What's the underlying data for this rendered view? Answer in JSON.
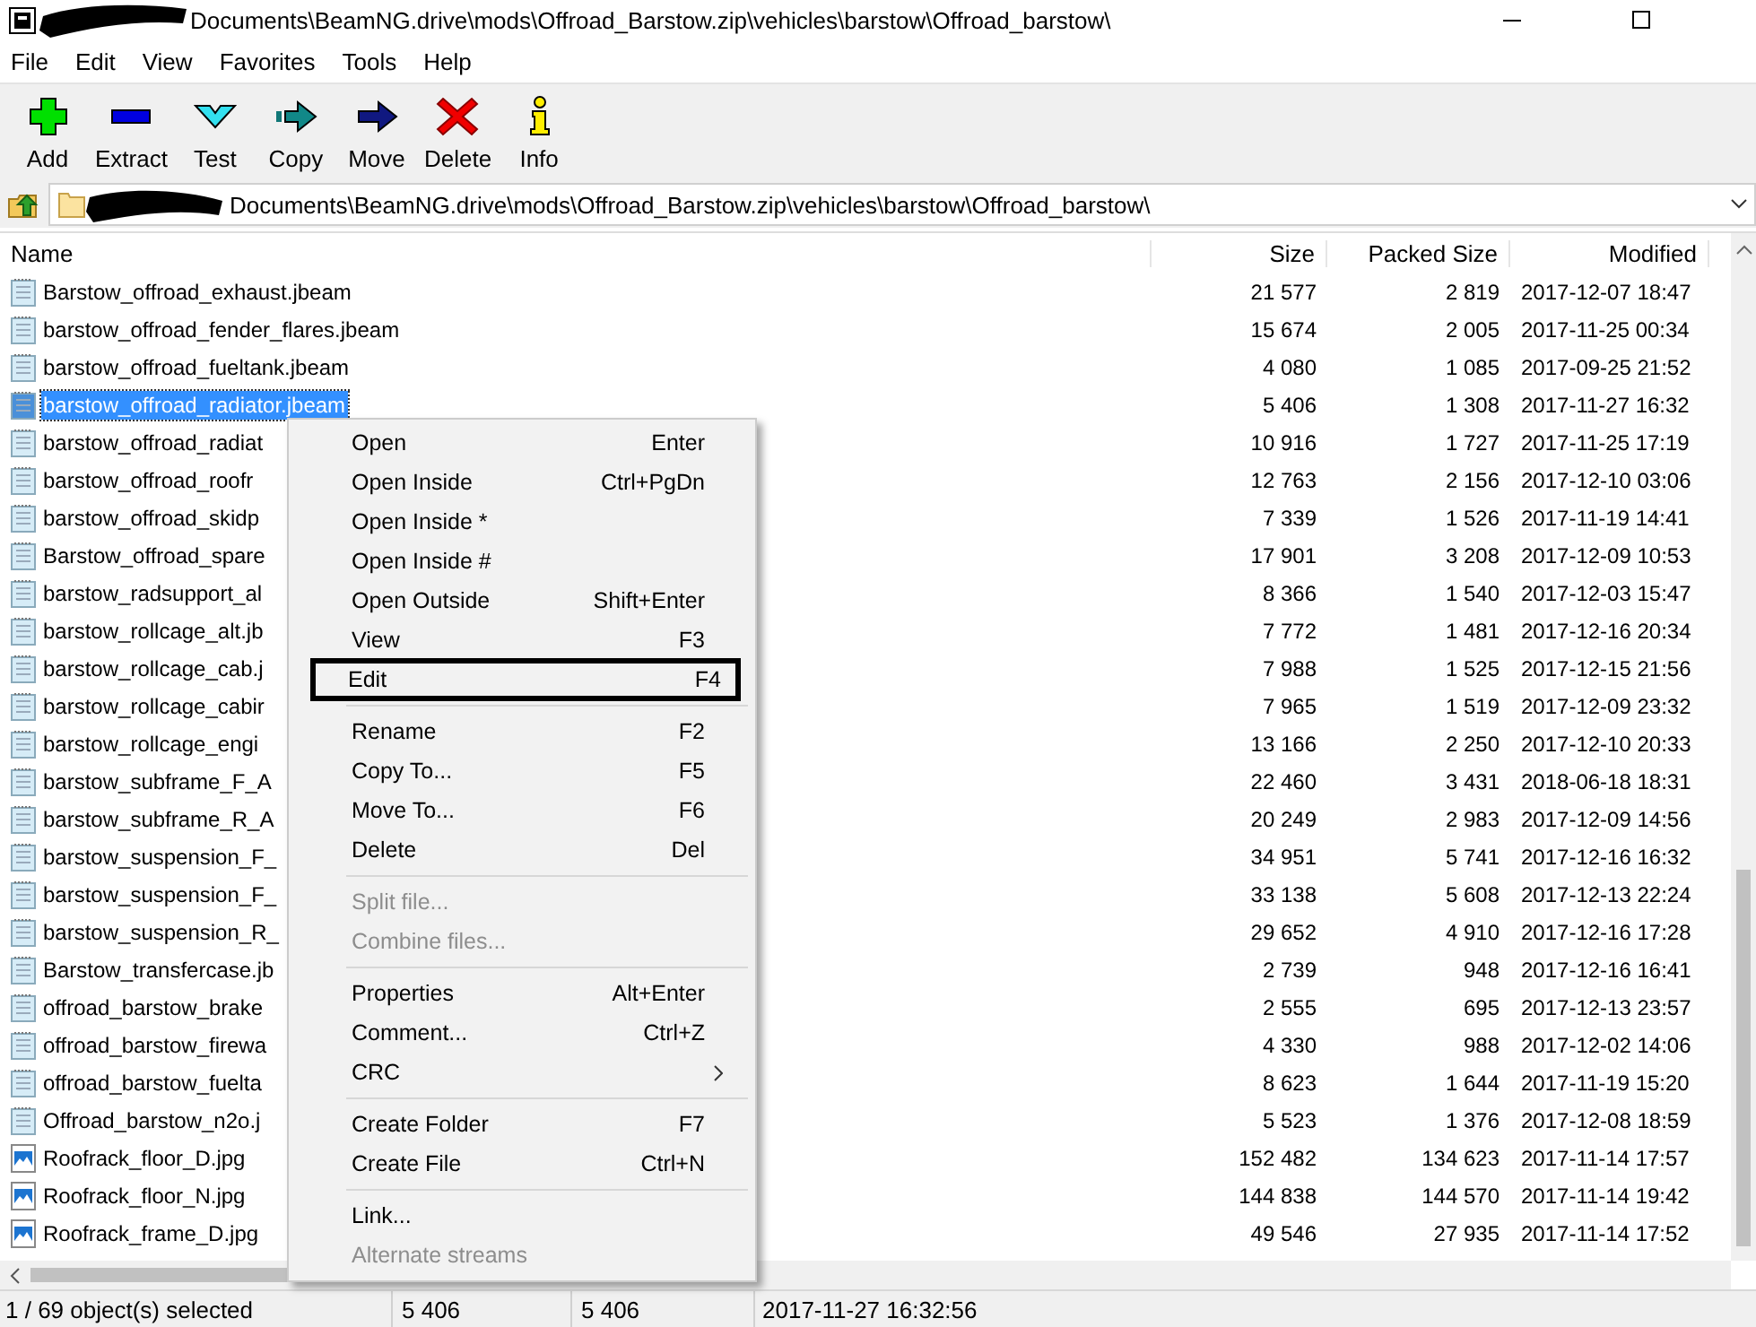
{
  "window": {
    "title": "Documents\\BeamNG.drive\\mods\\Offroad_Barstow.zip\\vehicles\\barstow\\Offroad_barstow\\"
  },
  "menu_bar": [
    "File",
    "Edit",
    "View",
    "Favorites",
    "Tools",
    "Help"
  ],
  "toolbar": [
    {
      "label": "Add",
      "kind": "add"
    },
    {
      "label": "Extract",
      "kind": "extract"
    },
    {
      "label": "Test",
      "kind": "test"
    },
    {
      "label": "Copy",
      "kind": "copy"
    },
    {
      "label": "Move",
      "kind": "move"
    },
    {
      "label": "Delete",
      "kind": "delete"
    },
    {
      "label": "Info",
      "kind": "info"
    }
  ],
  "address": {
    "value": "Documents\\BeamNG.drive\\mods\\Offroad_Barstow.zip\\vehicles\\barstow\\Offroad_barstow\\"
  },
  "table": {
    "columns": [
      "Name",
      "Size",
      "Packed Size",
      "Modified"
    ],
    "rows": [
      {
        "name": "Barstow_offroad_exhaust.jbeam",
        "kind": "text",
        "size": "21 577",
        "packed": "2 819",
        "modified": "2017-12-07 18:47",
        "selected": false
      },
      {
        "name": "barstow_offroad_fender_flares.jbeam",
        "kind": "text",
        "size": "15 674",
        "packed": "2 005",
        "modified": "2017-11-25 00:34",
        "selected": false
      },
      {
        "name": "barstow_offroad_fueltank.jbeam",
        "kind": "text",
        "size": "4 080",
        "packed": "1 085",
        "modified": "2017-09-25 21:52",
        "selected": false
      },
      {
        "name": "barstow_offroad_radiator.jbeam",
        "kind": "text",
        "size": "5 406",
        "packed": "1 308",
        "modified": "2017-11-27 16:32",
        "selected": true
      },
      {
        "name": "barstow_offroad_radiat",
        "kind": "text",
        "size": "10 916",
        "packed": "1 727",
        "modified": "2017-11-25 17:19",
        "selected": false
      },
      {
        "name": "barstow_offroad_roofr",
        "kind": "text",
        "size": "12 763",
        "packed": "2 156",
        "modified": "2017-12-10 03:06",
        "selected": false
      },
      {
        "name": "barstow_offroad_skidp",
        "kind": "text",
        "size": "7 339",
        "packed": "1 526",
        "modified": "2017-11-19 14:41",
        "selected": false
      },
      {
        "name": "Barstow_offroad_spare",
        "kind": "text",
        "size": "17 901",
        "packed": "3 208",
        "modified": "2017-12-09 10:53",
        "selected": false
      },
      {
        "name": "barstow_radsupport_al",
        "kind": "text",
        "size": "8 366",
        "packed": "1 540",
        "modified": "2017-12-03 15:47",
        "selected": false
      },
      {
        "name": "barstow_rollcage_alt.jb",
        "kind": "text",
        "size": "7 772",
        "packed": "1 481",
        "modified": "2017-12-16 20:34",
        "selected": false
      },
      {
        "name": "barstow_rollcage_cab.j",
        "kind": "text",
        "size": "7 988",
        "packed": "1 525",
        "modified": "2017-12-15 21:56",
        "selected": false
      },
      {
        "name": "barstow_rollcage_cabir",
        "kind": "text",
        "size": "7 965",
        "packed": "1 519",
        "modified": "2017-12-09 23:32",
        "selected": false
      },
      {
        "name": "barstow_rollcage_engi",
        "kind": "text",
        "size": "13 166",
        "packed": "2 250",
        "modified": "2017-12-10 20:33",
        "selected": false
      },
      {
        "name": "barstow_subframe_F_A",
        "kind": "text",
        "size": "22 460",
        "packed": "3 431",
        "modified": "2018-06-18 18:31",
        "selected": false
      },
      {
        "name": "barstow_subframe_R_A",
        "kind": "text",
        "size": "20 249",
        "packed": "2 983",
        "modified": "2017-12-09 14:56",
        "selected": false
      },
      {
        "name": "barstow_suspension_F_",
        "kind": "text",
        "size": "34 951",
        "packed": "5 741",
        "modified": "2017-12-16 16:32",
        "selected": false
      },
      {
        "name": "barstow_suspension_F_",
        "kind": "text",
        "size": "33 138",
        "packed": "5 608",
        "modified": "2017-12-13 22:24",
        "selected": false
      },
      {
        "name": "barstow_suspension_R_",
        "kind": "text",
        "size": "29 652",
        "packed": "4 910",
        "modified": "2017-12-16 17:28",
        "selected": false
      },
      {
        "name": "Barstow_transfercase.jb",
        "kind": "text",
        "size": "2 739",
        "packed": "948",
        "modified": "2017-12-16 16:41",
        "selected": false
      },
      {
        "name": "offroad_barstow_brake",
        "kind": "text",
        "size": "2 555",
        "packed": "695",
        "modified": "2017-12-13 23:57",
        "selected": false
      },
      {
        "name": "offroad_barstow_firewa",
        "kind": "text",
        "size": "4 330",
        "packed": "988",
        "modified": "2017-12-02 14:06",
        "selected": false
      },
      {
        "name": "offroad_barstow_fuelta",
        "kind": "text",
        "size": "8 623",
        "packed": "1 644",
        "modified": "2017-11-19 15:20",
        "selected": false
      },
      {
        "name": "Offroad_barstow_n2o.j",
        "kind": "text",
        "size": "5 523",
        "packed": "1 376",
        "modified": "2017-12-08 18:59",
        "selected": false
      },
      {
        "name": "Roofrack_floor_D.jpg",
        "kind": "image",
        "size": "152 482",
        "packed": "134 623",
        "modified": "2017-11-14 17:57",
        "selected": false
      },
      {
        "name": "Roofrack_floor_N.jpg",
        "kind": "image",
        "size": "144 838",
        "packed": "144 570",
        "modified": "2017-11-14 19:42",
        "selected": false
      },
      {
        "name": "Roofrack_frame_D.jpg",
        "kind": "image",
        "size": "49 546",
        "packed": "27 935",
        "modified": "2017-11-14 17:52",
        "selected": false
      }
    ]
  },
  "context_menu": [
    {
      "kind": "item",
      "label": "Open",
      "shortcut": "Enter",
      "disabled": false,
      "highlighted": false
    },
    {
      "kind": "item",
      "label": "Open Inside",
      "shortcut": "Ctrl+PgDn",
      "disabled": false,
      "highlighted": false
    },
    {
      "kind": "item",
      "label": "Open Inside *",
      "disabled": false,
      "highlighted": false
    },
    {
      "kind": "item",
      "label": "Open Inside #",
      "disabled": false,
      "highlighted": false
    },
    {
      "kind": "item",
      "label": "Open Outside",
      "shortcut": "Shift+Enter",
      "disabled": false,
      "highlighted": false
    },
    {
      "kind": "item",
      "label": "View",
      "shortcut": "F3",
      "disabled": false,
      "highlighted": false
    },
    {
      "kind": "item",
      "label": "Edit",
      "shortcut": "F4",
      "disabled": false,
      "highlighted": true
    },
    {
      "kind": "separator"
    },
    {
      "kind": "item",
      "label": "Rename",
      "shortcut": "F2",
      "disabled": false,
      "highlighted": false
    },
    {
      "kind": "item",
      "label": "Copy To...",
      "shortcut": "F5",
      "disabled": false,
      "highlighted": false
    },
    {
      "kind": "item",
      "label": "Move To...",
      "shortcut": "F6",
      "disabled": false,
      "highlighted": false
    },
    {
      "kind": "item",
      "label": "Delete",
      "shortcut": "Del",
      "disabled": false,
      "highlighted": false
    },
    {
      "kind": "separator"
    },
    {
      "kind": "item",
      "label": "Split file...",
      "disabled": true,
      "highlighted": false
    },
    {
      "kind": "item",
      "label": "Combine files...",
      "disabled": true,
      "highlighted": false
    },
    {
      "kind": "separator"
    },
    {
      "kind": "item",
      "label": "Properties",
      "shortcut": "Alt+Enter",
      "disabled": false,
      "highlighted": false
    },
    {
      "kind": "item",
      "label": "Comment...",
      "shortcut": "Ctrl+Z",
      "disabled": false,
      "highlighted": false
    },
    {
      "kind": "submenu",
      "label": "CRC",
      "disabled": false,
      "highlighted": false
    },
    {
      "kind": "separator"
    },
    {
      "kind": "item",
      "label": "Create Folder",
      "shortcut": "F7",
      "disabled": false,
      "highlighted": false
    },
    {
      "kind": "item",
      "label": "Create File",
      "shortcut": "Ctrl+N",
      "disabled": false,
      "highlighted": false
    },
    {
      "kind": "separator"
    },
    {
      "kind": "item",
      "label": "Link...",
      "disabled": false,
      "highlighted": false
    },
    {
      "kind": "item",
      "label": "Alternate streams",
      "disabled": true,
      "highlighted": false
    }
  ],
  "status_bar": [
    "1 / 69 object(s) selected",
    "5 406",
    "5 406",
    "2017-11-27 16:32:56"
  ]
}
